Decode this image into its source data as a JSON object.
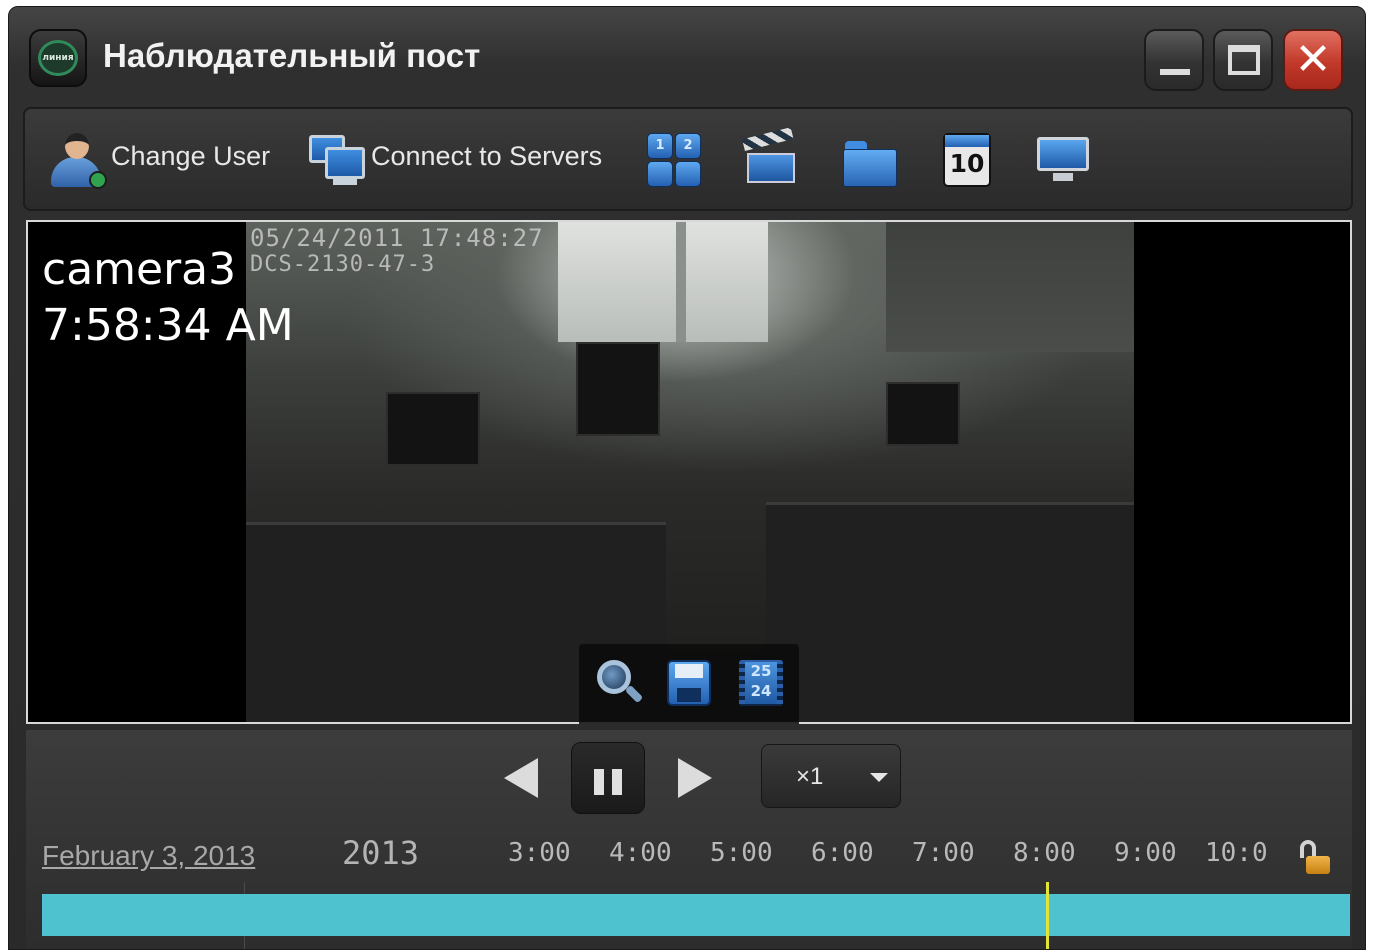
{
  "window": {
    "title": "Наблюдательный пост",
    "logo_text": "линия"
  },
  "toolbar": {
    "change_user_label": "Change User",
    "connect_servers_label": "Connect to Servers",
    "calendar_day": "10",
    "icons": [
      "user-icon",
      "servers-icon",
      "layout-grid-icon",
      "clapperboard-icon",
      "folder-icon",
      "calendar-icon",
      "monitor-icon"
    ],
    "layout_numbers": [
      "1",
      "2"
    ]
  },
  "video": {
    "camera_name": "camera3",
    "time": "7:58:34 AM",
    "osd_datetime": "05/24/2011 17:48:27",
    "osd_id": "DCS-2130-47-3",
    "controls": [
      "zoom-icon",
      "save-icon",
      "fps-icon"
    ],
    "fps_top": "25",
    "fps_bottom": "24"
  },
  "playback": {
    "speed": "×1",
    "date": "February 3, 2013",
    "year": "2013",
    "ticks": [
      "3:00",
      "4:00",
      "5:00",
      "6:00",
      "7:00",
      "8:00",
      "9:00",
      "10:0"
    ],
    "cursor_time": "7:58:34 AM",
    "timeline_color": "#4ec3cf",
    "cursor_color": "#e3e33a"
  }
}
